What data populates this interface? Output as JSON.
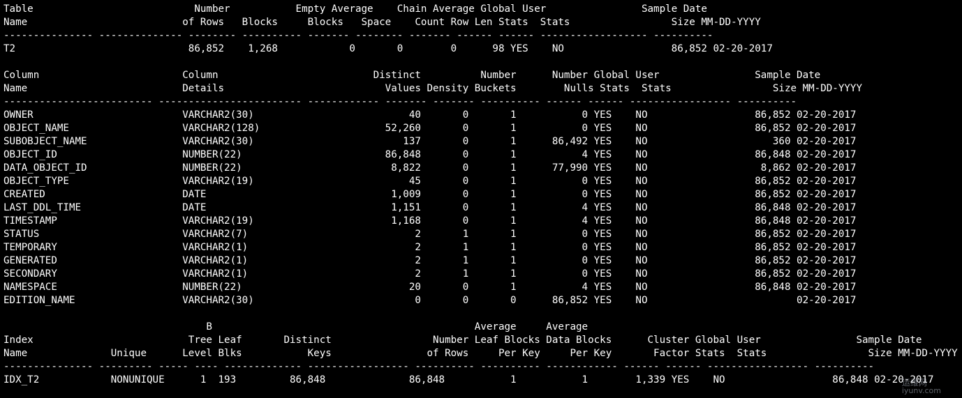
{
  "terminal": {
    "background": "#000000",
    "foreground": "#ffffff",
    "lines": [
      "Table                           Number           Empty Average    Chain Average Global User                Sample Date",
      "Name                          of Rows   Blocks     Blocks   Space    Count Row Len Stats  Stats                 Size MM-DD-YYYY",
      "--------------- -------------- -------- ---------- ------- -------- ------- ------ ------ ------------------ ----------",
      "T2                             86,852    1,268            0       0        0      98 YES    NO                  86,852 02-20-2017",
      "",
      "Column                        Column                          Distinct          Number      Number Global User                Sample Date",
      "Name                          Details                           Values Density Buckets        Nulls Stats  Stats                 Size MM-DD-YYYY",
      "------------------------- ------------------------ ------------ ------- ------- ---------- ------ ------ ----------------- ----------",
      "OWNER                         VARCHAR2(30)                          40       0       1           0 YES    NO                  86,852 02-20-2017",
      "OBJECT_NAME                   VARCHAR2(128)                     52,260       0       1           0 YES    NO                  86,852 02-20-2017",
      "SUBOBJECT_NAME                VARCHAR2(30)                         137       0       1      86,492 YES    NO                     360 02-20-2017",
      "OBJECT_ID                     NUMBER(22)                        86,848       0       1           4 YES    NO                  86,848 02-20-2017",
      "DATA_OBJECT_ID                NUMBER(22)                         8,822       0       1      77,990 YES    NO                   8,862 02-20-2017",
      "OBJECT_TYPE                   VARCHAR2(19)                          45       0       1           0 YES    NO                  86,852 02-20-2017",
      "CREATED                       DATE                               1,009       0       1           0 YES    NO                  86,852 02-20-2017",
      "LAST_DDL_TIME                 DATE                               1,151       0       1           4 YES    NO                  86,848 02-20-2017",
      "TIMESTAMP                     VARCHAR2(19)                       1,168       0       1           4 YES    NO                  86,848 02-20-2017",
      "STATUS                        VARCHAR2(7)                            2       1       1           0 YES    NO                  86,852 02-20-2017",
      "TEMPORARY                     VARCHAR2(1)                            2       1       1           0 YES    NO                  86,852 02-20-2017",
      "GENERATED                     VARCHAR2(1)                            2       1       1           0 YES    NO                  86,852 02-20-2017",
      "SECONDARY                     VARCHAR2(1)                            2       1       1           0 YES    NO                  86,852 02-20-2017",
      "NAMESPACE                     NUMBER(22)                            20       0       1           4 YES    NO                  86,848 02-20-2017",
      "EDITION_NAME                  VARCHAR2(30)                           0       0       0      86,852 YES    NO                         02-20-2017",
      "",
      "                                  B                                            Average     Average",
      "Index                          Tree Leaf       Distinct                 Number Leaf Blocks Data Blocks      Cluster Global User                Sample Date",
      "Name              Unique      Level Blks           Keys                of Rows     Per Key     Per Key       Factor Stats  Stats                 Size MM-DD-YYYY",
      "--------------- --------- ----- ---- ------------- ----------------- ---------- ---------- ------------ ------ ------ ----------------- ----------",
      "IDX_T2            NONUNIQUE      1  193         86,848              86,848           1           1        1,339 YES    NO                  86,848 02-20-2017"
    ]
  },
  "watermark": {
    "cn_text": "运维网",
    "url": "iyunv.com",
    "color": "#cfd8e6"
  }
}
